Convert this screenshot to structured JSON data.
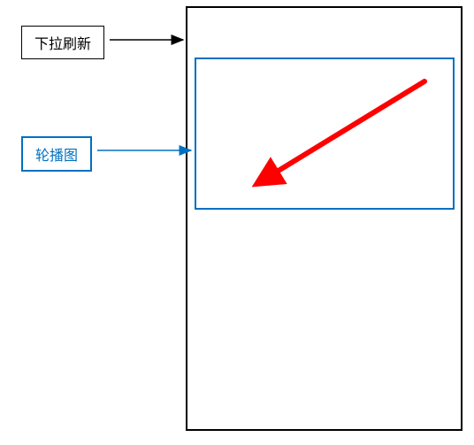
{
  "labels": {
    "pull_refresh": "下拉刷新",
    "carousel": "轮播图"
  },
  "colors": {
    "black": "#000000",
    "blue": "#0070c0",
    "red": "#ff0000"
  }
}
